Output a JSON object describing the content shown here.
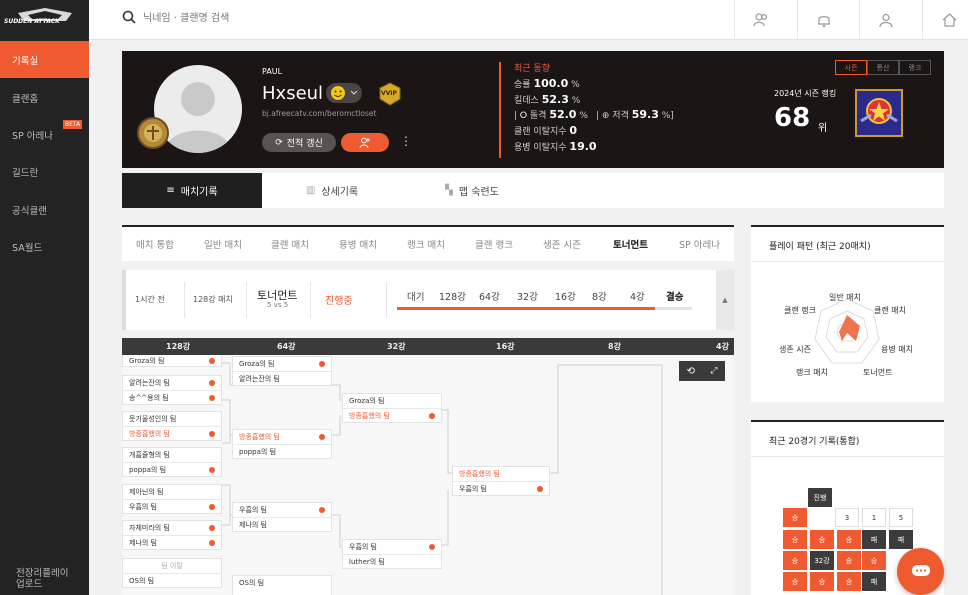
{
  "sidebar": {
    "logo_text": "SUDDEN ATTACK",
    "items": [
      {
        "label": "기록실"
      },
      {
        "label": "클랜홈"
      },
      {
        "label": "SP 아레나",
        "badge": "BETA"
      },
      {
        "label": "길드란"
      },
      {
        "label": "공식클랜"
      },
      {
        "label": "SA월드"
      },
      {
        "label": "전장리플레이 업로드"
      }
    ]
  },
  "search": {
    "placeholder": "닉네임 · 클랜명 검색"
  },
  "profile": {
    "guild": "PAUL",
    "nickname": "Hxseul",
    "vip": "VVIP",
    "url": "bj.afreecatv.com/beromctloset",
    "refresh": "전적 갱신",
    "recent_title": "최근 동향",
    "stats": {
      "win_label": "승률",
      "win_value": "100.0",
      "kd_label": "킬데스",
      "kd_value": "52.3",
      "hs_label": "| 🞇 돌격",
      "hs_value": "52.0",
      "sn_label": "| ⊕ 저격",
      "sn_value": "59.3",
      "clan_leave_label": "클랜 이탈지수",
      "clan_leave_value": "0",
      "merc_leave_label": "용병 이탈지수",
      "merc_leave_value": "19.0"
    },
    "season_tabs": [
      "시즌",
      "통산",
      "랭크"
    ],
    "season_rank_label": "2024년 시즌 랭킹",
    "rank": "68",
    "rank_unit": "위"
  },
  "main_tabs": [
    "매치기록",
    "상세기록",
    "맵 숙련도"
  ],
  "categories": [
    "매치 통합",
    "일반 매치",
    "클랜 매치",
    "용병 매치",
    "랭크 매치",
    "클랜 랭크",
    "생존 시즌",
    "토너먼트",
    "SP 아레나"
  ],
  "tournament": {
    "time": "1시간 전",
    "kind": "128강 매치",
    "title": "토너먼트",
    "mode": "5 vs 5",
    "status": "진행중",
    "stages": [
      "대기",
      "128강",
      "64강",
      "32강",
      "16강",
      "8강",
      "4강",
      "결승"
    ]
  },
  "bracket": {
    "headers": [
      "128강",
      "64강",
      "32강",
      "16강",
      "8강",
      "4강"
    ],
    "r128": [
      "Groza의 팀",
      "알려는잔의 팀",
      "송^^용의 팀",
      "뭇기울성인의 팀",
      "방종흡했의 팀",
      "개흡쥴형의 팀",
      "poppa의 팀",
      "제아닌의 팀",
      "우흡의 팀",
      "자체미라의 팀",
      "제나의 팀",
      "팀 이탈",
      "OS의 팀"
    ],
    "r64": [
      "Groza의 팀",
      "알려는잔의 팀",
      "방종흡했의 팀",
      "poppa의 팀",
      "우흡의 팀",
      "제나의 팀",
      "OS의 팀"
    ],
    "r32": [
      "Groza의 팀",
      "방종흡했의 팀",
      "우흡의 팀",
      "luther의 팀"
    ],
    "r16": [
      "방종흡했의 팀",
      "우흡의 팀"
    ]
  },
  "pattern": {
    "title": "플레이 패턴 (최근 20매치)",
    "labels": [
      "일반 매치",
      "클랜 매치",
      "용병 매치",
      "토너먼트",
      "랭크 매치",
      "생존 시즌",
      "클랜 랭크"
    ]
  },
  "recent20": {
    "title": "최근 20경기 기록(통합)",
    "status": "진행",
    "grid": [
      [
        "승",
        "",
        "3",
        "1",
        "5"
      ],
      [
        "승",
        "승",
        "승",
        "패",
        "패"
      ],
      [
        "승",
        "32강",
        "승",
        "승",
        ""
      ],
      [
        "승",
        "승",
        "승",
        "패",
        ""
      ]
    ]
  }
}
